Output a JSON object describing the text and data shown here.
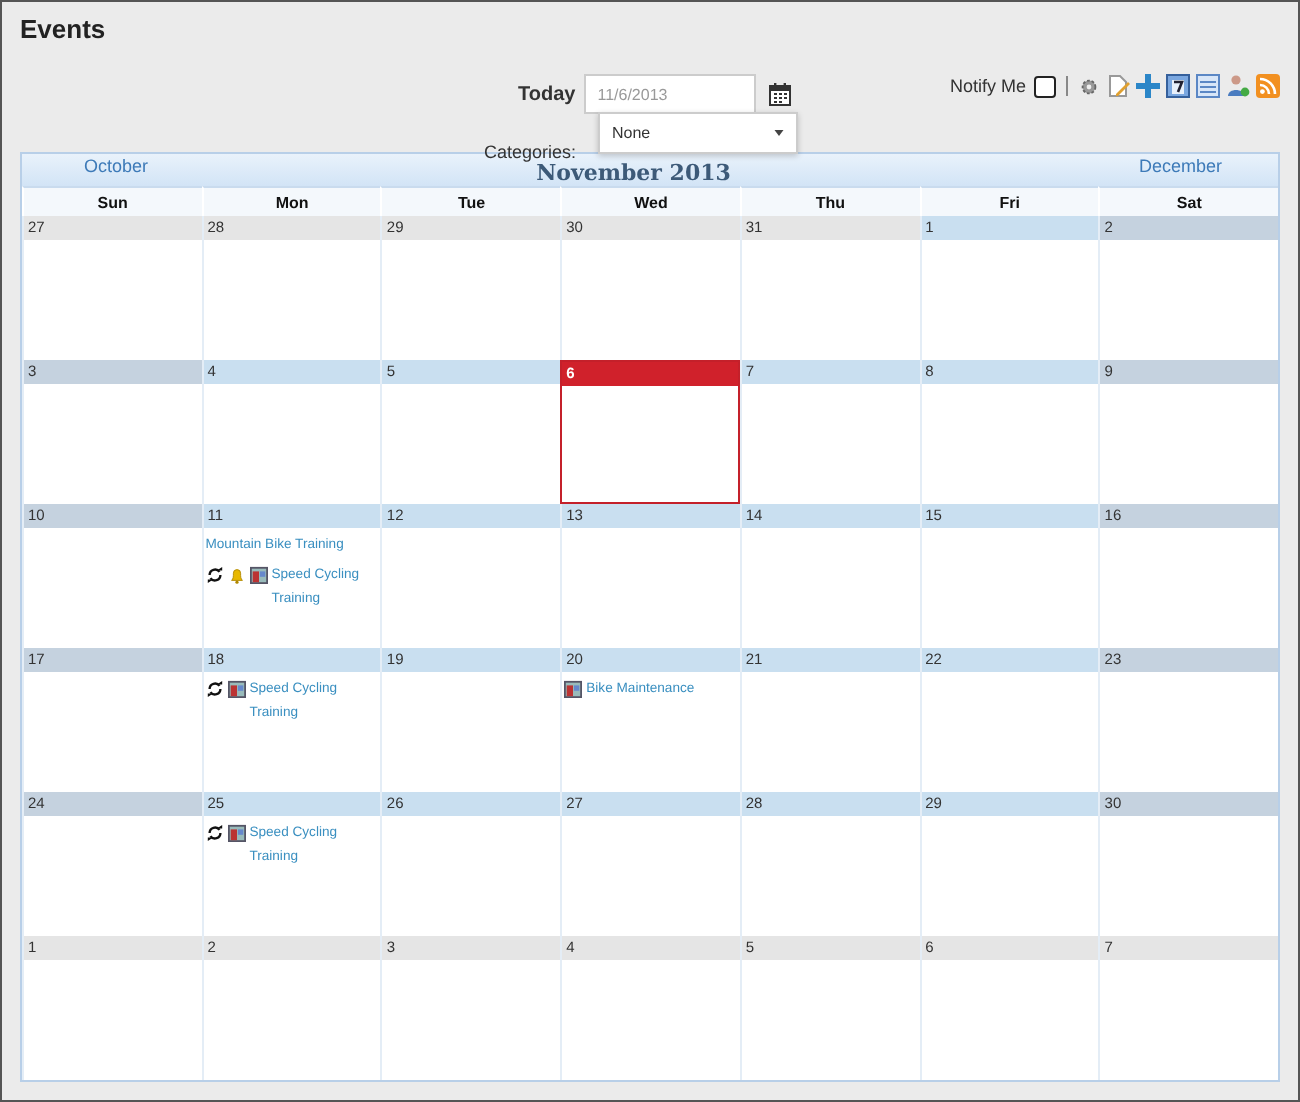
{
  "title": "Events",
  "today_label": "Today",
  "date_field": {
    "value": "11/6/2013"
  },
  "notify": {
    "label": "Notify Me",
    "checked": false
  },
  "categories": {
    "label": "Categories:",
    "value": "None"
  },
  "calendar": {
    "prev": "October",
    "month": "November 2013",
    "next": "December",
    "weekdays": [
      "Sun",
      "Mon",
      "Tue",
      "Wed",
      "Thu",
      "Fri",
      "Sat"
    ],
    "weeks": [
      [
        {
          "day": "27",
          "kind": "other"
        },
        {
          "day": "28",
          "kind": "other"
        },
        {
          "day": "29",
          "kind": "other"
        },
        {
          "day": "30",
          "kind": "other"
        },
        {
          "day": "31",
          "kind": "other"
        },
        {
          "day": "1",
          "kind": "current"
        },
        {
          "day": "2",
          "kind": "current"
        }
      ],
      [
        {
          "day": "3",
          "kind": "current"
        },
        {
          "day": "4",
          "kind": "current"
        },
        {
          "day": "5",
          "kind": "current"
        },
        {
          "day": "6",
          "kind": "today"
        },
        {
          "day": "7",
          "kind": "current"
        },
        {
          "day": "8",
          "kind": "current"
        },
        {
          "day": "9",
          "kind": "current"
        }
      ],
      [
        {
          "day": "10",
          "kind": "current"
        },
        {
          "day": "11",
          "kind": "current",
          "events": [
            {
              "title": "Mountain Bike Training",
              "recurring": false,
              "reminder": false,
              "category_icon": false
            },
            {
              "title": "Speed Cycling Training",
              "recurring": true,
              "reminder": true,
              "category_icon": true
            }
          ]
        },
        {
          "day": "12",
          "kind": "current"
        },
        {
          "day": "13",
          "kind": "current"
        },
        {
          "day": "14",
          "kind": "current"
        },
        {
          "day": "15",
          "kind": "current"
        },
        {
          "day": "16",
          "kind": "current"
        }
      ],
      [
        {
          "day": "17",
          "kind": "current"
        },
        {
          "day": "18",
          "kind": "current",
          "events": [
            {
              "title": "Speed Cycling Training",
              "recurring": true,
              "reminder": false,
              "category_icon": true
            }
          ]
        },
        {
          "day": "19",
          "kind": "current"
        },
        {
          "day": "20",
          "kind": "current",
          "events": [
            {
              "title": "Bike Maintenance",
              "recurring": false,
              "reminder": false,
              "category_icon": true
            }
          ]
        },
        {
          "day": "21",
          "kind": "current"
        },
        {
          "day": "22",
          "kind": "current"
        },
        {
          "day": "23",
          "kind": "current"
        }
      ],
      [
        {
          "day": "24",
          "kind": "current"
        },
        {
          "day": "25",
          "kind": "current",
          "events": [
            {
              "title": "Speed Cycling Training",
              "recurring": true,
              "reminder": false,
              "category_icon": true
            }
          ]
        },
        {
          "day": "26",
          "kind": "current"
        },
        {
          "day": "27",
          "kind": "current"
        },
        {
          "day": "28",
          "kind": "current"
        },
        {
          "day": "29",
          "kind": "current"
        },
        {
          "day": "30",
          "kind": "current"
        }
      ],
      [
        {
          "day": "1",
          "kind": "other"
        },
        {
          "day": "2",
          "kind": "other"
        },
        {
          "day": "3",
          "kind": "other"
        },
        {
          "day": "4",
          "kind": "other"
        },
        {
          "day": "5",
          "kind": "other"
        },
        {
          "day": "6",
          "kind": "other"
        },
        {
          "day": "7",
          "kind": "other"
        }
      ]
    ]
  }
}
